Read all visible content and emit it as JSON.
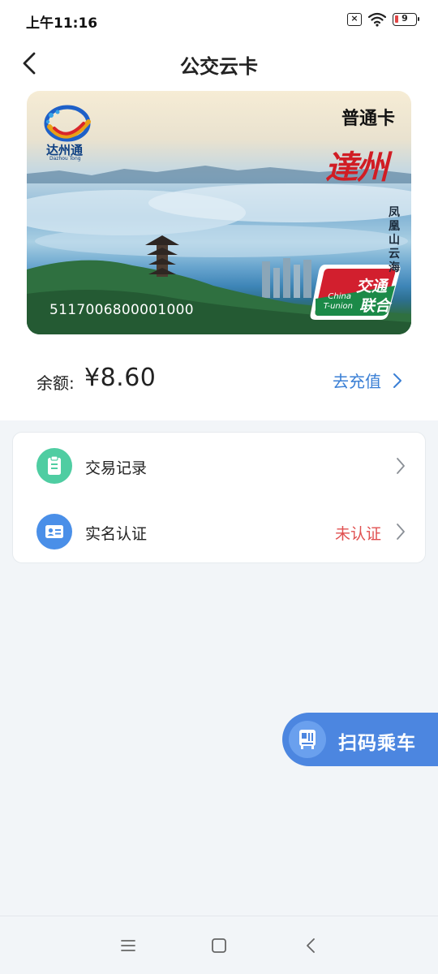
{
  "status_bar": {
    "time": "上午11:16",
    "sim_icon": "sim-x-icon",
    "wifi_icon": "wifi-icon",
    "battery_level": "9"
  },
  "header": {
    "title": "公交云卡",
    "back_icon": "back-arrow-icon"
  },
  "card": {
    "type_label": "普通卡",
    "logo_text": "达州通",
    "logo_subtext": "Dazhou Tong",
    "city_script": "達州",
    "scenic_name": "凤凰山云海",
    "card_number": "5117006800001000",
    "tunion_cn_1": "交通",
    "tunion_cn_2": "联合",
    "tunion_en_1": "China",
    "tunion_en_2": "T-union"
  },
  "balance": {
    "label": "余额:",
    "value": "¥8.60",
    "recharge_label": "去充值"
  },
  "menu": {
    "items": [
      {
        "label": "交易记录",
        "icon": "clipboard-icon",
        "status": ""
      },
      {
        "label": "实名认证",
        "icon": "id-card-icon",
        "status": "未认证"
      }
    ]
  },
  "scan_button": {
    "label": "扫码乘车",
    "icon": "bus-icon"
  },
  "nav": {
    "menu_icon": "menu-icon",
    "home_icon": "home-icon",
    "back_icon": "back-icon"
  },
  "colors": {
    "accent": "#3a7fd5",
    "warning": "#e05050",
    "scan_button": "#4c86e0",
    "record_icon": "#4fcda2",
    "auth_icon": "#4a8fe8"
  }
}
